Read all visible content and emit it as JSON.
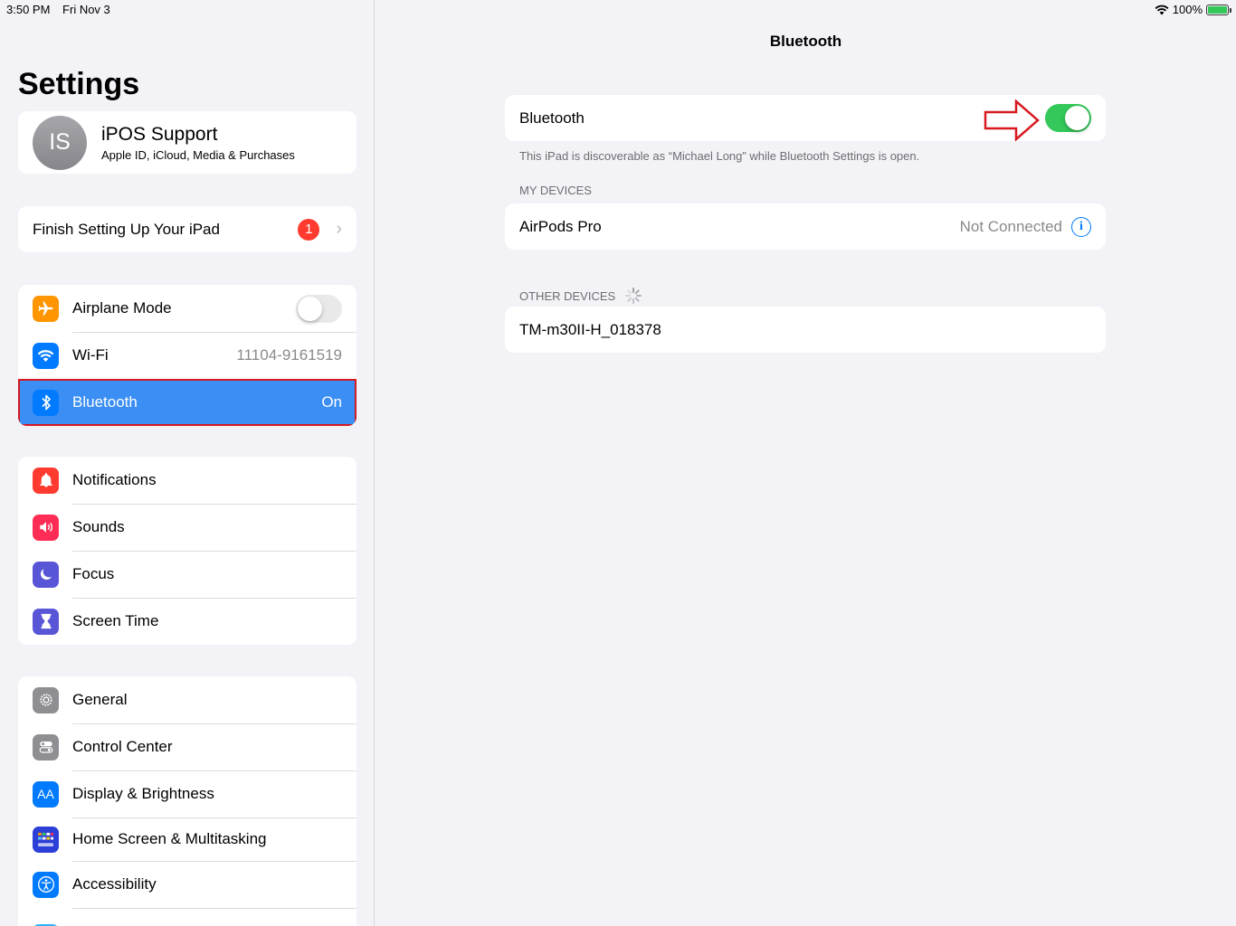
{
  "status_bar": {
    "time": "3:50 PM",
    "date": "Fri Nov 3",
    "battery": "100%"
  },
  "sidebar": {
    "title": "Settings",
    "profile": {
      "initials": "IS",
      "name": "iPOS Support",
      "subtitle": "Apple ID, iCloud, Media & Purchases"
    },
    "finish_setup": {
      "label": "Finish Setting Up Your iPad",
      "badge": "1"
    },
    "connectivity": [
      {
        "label": "Airplane Mode",
        "icon": "airplane-icon",
        "color": "#ff9500",
        "toggle": "off"
      },
      {
        "label": "Wi-Fi",
        "icon": "wifi-icon",
        "color": "#007aff",
        "value": "11104-9161519"
      },
      {
        "label": "Bluetooth",
        "icon": "bluetooth-icon",
        "color": "#007aff",
        "value": "On",
        "selected": true
      }
    ],
    "alerts": [
      {
        "label": "Notifications",
        "icon": "bell-icon",
        "color": "#ff3b30"
      },
      {
        "label": "Sounds",
        "icon": "speaker-icon",
        "color": "#ff2d55"
      },
      {
        "label": "Focus",
        "icon": "moon-icon",
        "color": "#5856d6"
      },
      {
        "label": "Screen Time",
        "icon": "hourglass-icon",
        "color": "#5856d6"
      }
    ],
    "system": [
      {
        "label": "General",
        "icon": "gear-icon",
        "color": "#8e8e93"
      },
      {
        "label": "Control Center",
        "icon": "switches-icon",
        "color": "#8e8e93"
      },
      {
        "label": "Display & Brightness",
        "icon": "text-size-icon",
        "color": "#007aff"
      },
      {
        "label": "Home Screen & Multitasking",
        "icon": "grid-icon",
        "color": "#2c3fd6"
      },
      {
        "label": "Accessibility",
        "icon": "accessibility-icon",
        "color": "#007aff"
      }
    ]
  },
  "detail": {
    "title": "Bluetooth",
    "bluetooth_row": {
      "label": "Bluetooth",
      "toggle": "on"
    },
    "discoverable_note": "This iPad is discoverable as “Michael Long” while Bluetooth Settings is open.",
    "my_devices_header": "MY DEVICES",
    "my_devices": [
      {
        "name": "AirPods Pro",
        "status": "Not Connected"
      }
    ],
    "other_devices_header": "OTHER DEVICES",
    "other_devices": [
      {
        "name": "TM-m30II-H_018378"
      }
    ]
  }
}
